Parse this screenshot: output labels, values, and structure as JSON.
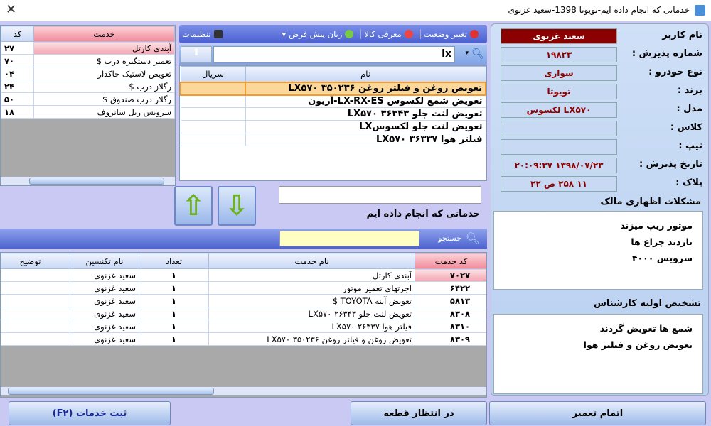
{
  "window": {
    "title": "خدماتی که انجام داده ایم-تویوتا 1398-سعید غزنوی",
    "close": "✕"
  },
  "info": {
    "fields": [
      {
        "label": "نام کاربر",
        "value": "سعید غزنوی"
      },
      {
        "label": "شماره پذیرش :",
        "value": "۱۹۸۲۳"
      },
      {
        "label": "نوع خودرو :",
        "value": "سواری"
      },
      {
        "label": "برند :",
        "value": "تویوتا"
      },
      {
        "label": "مدل :",
        "value": "LX۵۷۰ لکسوس"
      },
      {
        "label": "کلاس :",
        "value": ""
      },
      {
        "label": "تیپ :",
        "value": ""
      },
      {
        "label": "تاریخ پذیرش :",
        "value": "۱۳۹۸/۰۷/۲۳ ۲۰:۰۹:۳۷"
      },
      {
        "label": "پلاک :",
        "value": "۱۱ ۲۵۸ ص ۲۲"
      }
    ],
    "owner_issues_label": "مشکلات اظهاری مالک",
    "owner_issues": [
      "موتور ریپ میزند",
      "بازدید چراغ ها",
      "سرویس ۴۰۰۰"
    ],
    "diagnosis_label": "تشخیص اولیه کارشناس",
    "diagnosis": [
      "شمع ها تعویض گردند",
      "تعویض روغن و فیلتر هوا"
    ]
  },
  "toolbar": {
    "change_status": "تغییر وضعیت",
    "product_intro": "معرفی کالا",
    "default_language": "زبان پیش فرض",
    "settings": "تنظیمات"
  },
  "search": {
    "value": "lx"
  },
  "catalog": {
    "headers": [
      "نام",
      "سریال"
    ],
    "rows": [
      [
        "تعویض روغن و فیلتر روغن ۳۵۰۲۳۶ LX۵۷۰",
        ""
      ],
      [
        "تعویض شمع لکسوس LX-RX-ES-آریون",
        ""
      ],
      [
        "تعویض لنت جلو ۳۶۳۴۳ LX۵۷۰",
        ""
      ],
      [
        "تعویض لنت جلو لکسوسLX",
        ""
      ],
      [
        "فیلتر هوا ۳۶۳۳۷ LX۵۷۰",
        ""
      ]
    ]
  },
  "services": {
    "headers": [
      "خدمت",
      "کد"
    ],
    "rows": [
      [
        "آبندی کارتل",
        "۲۷"
      ],
      [
        "تعمیر دستگیره درب $",
        "۷۰"
      ],
      [
        "تعویض لاستیک چاکدار",
        "۰۴"
      ],
      [
        "رگلاز درب $",
        "۲۴"
      ],
      [
        "رگلاز درب صندوق $",
        "۵۰"
      ],
      [
        "سرویس ریل سانروف",
        "۱۸"
      ]
    ]
  },
  "done": {
    "label": "خدماتی که انجام داده ایم",
    "search_label": "جستجو",
    "headers": [
      "کد خدمت",
      "نام خدمت",
      "تعداد",
      "نام تکنسین",
      "توضیح"
    ],
    "rows": [
      [
        "۷۰۲۷",
        "آبندی کارتل",
        "۱",
        "سعید غزنوی",
        ""
      ],
      [
        "۶۴۲۲",
        "اجرتهای تعمیر موتور",
        "۱",
        "سعید غزنوی",
        ""
      ],
      [
        "۵۸۱۳",
        "تعویض آینه TOYOTA $",
        "۱",
        "سعید غزنوی",
        ""
      ],
      [
        "۸۳۰۸",
        "تعویض لنت جلو ۲۶۳۴۳ LX۵۷۰",
        "۱",
        "سعید غزنوی",
        ""
      ],
      [
        "۸۳۱۰",
        "فیلتر هوا ۲۶۳۳۷ LX۵۷۰",
        "۱",
        "سعید غزنوی",
        ""
      ],
      [
        "۸۳۰۹",
        "تعویض روغن و فیلتر روغن ۳۵۰۲۳۶ LX۵۷۰",
        "۱",
        "سعید غزنوی",
        ""
      ]
    ]
  },
  "buttons": {
    "register": "ثبت خدمات (F۲)",
    "waiting_parts": "در انتظار قطعه",
    "finish": "اتمام تعمیر"
  },
  "colors": {
    "background": "#c9c9f3",
    "accent_red": "#8b0000",
    "selection": "#fbd79a"
  }
}
